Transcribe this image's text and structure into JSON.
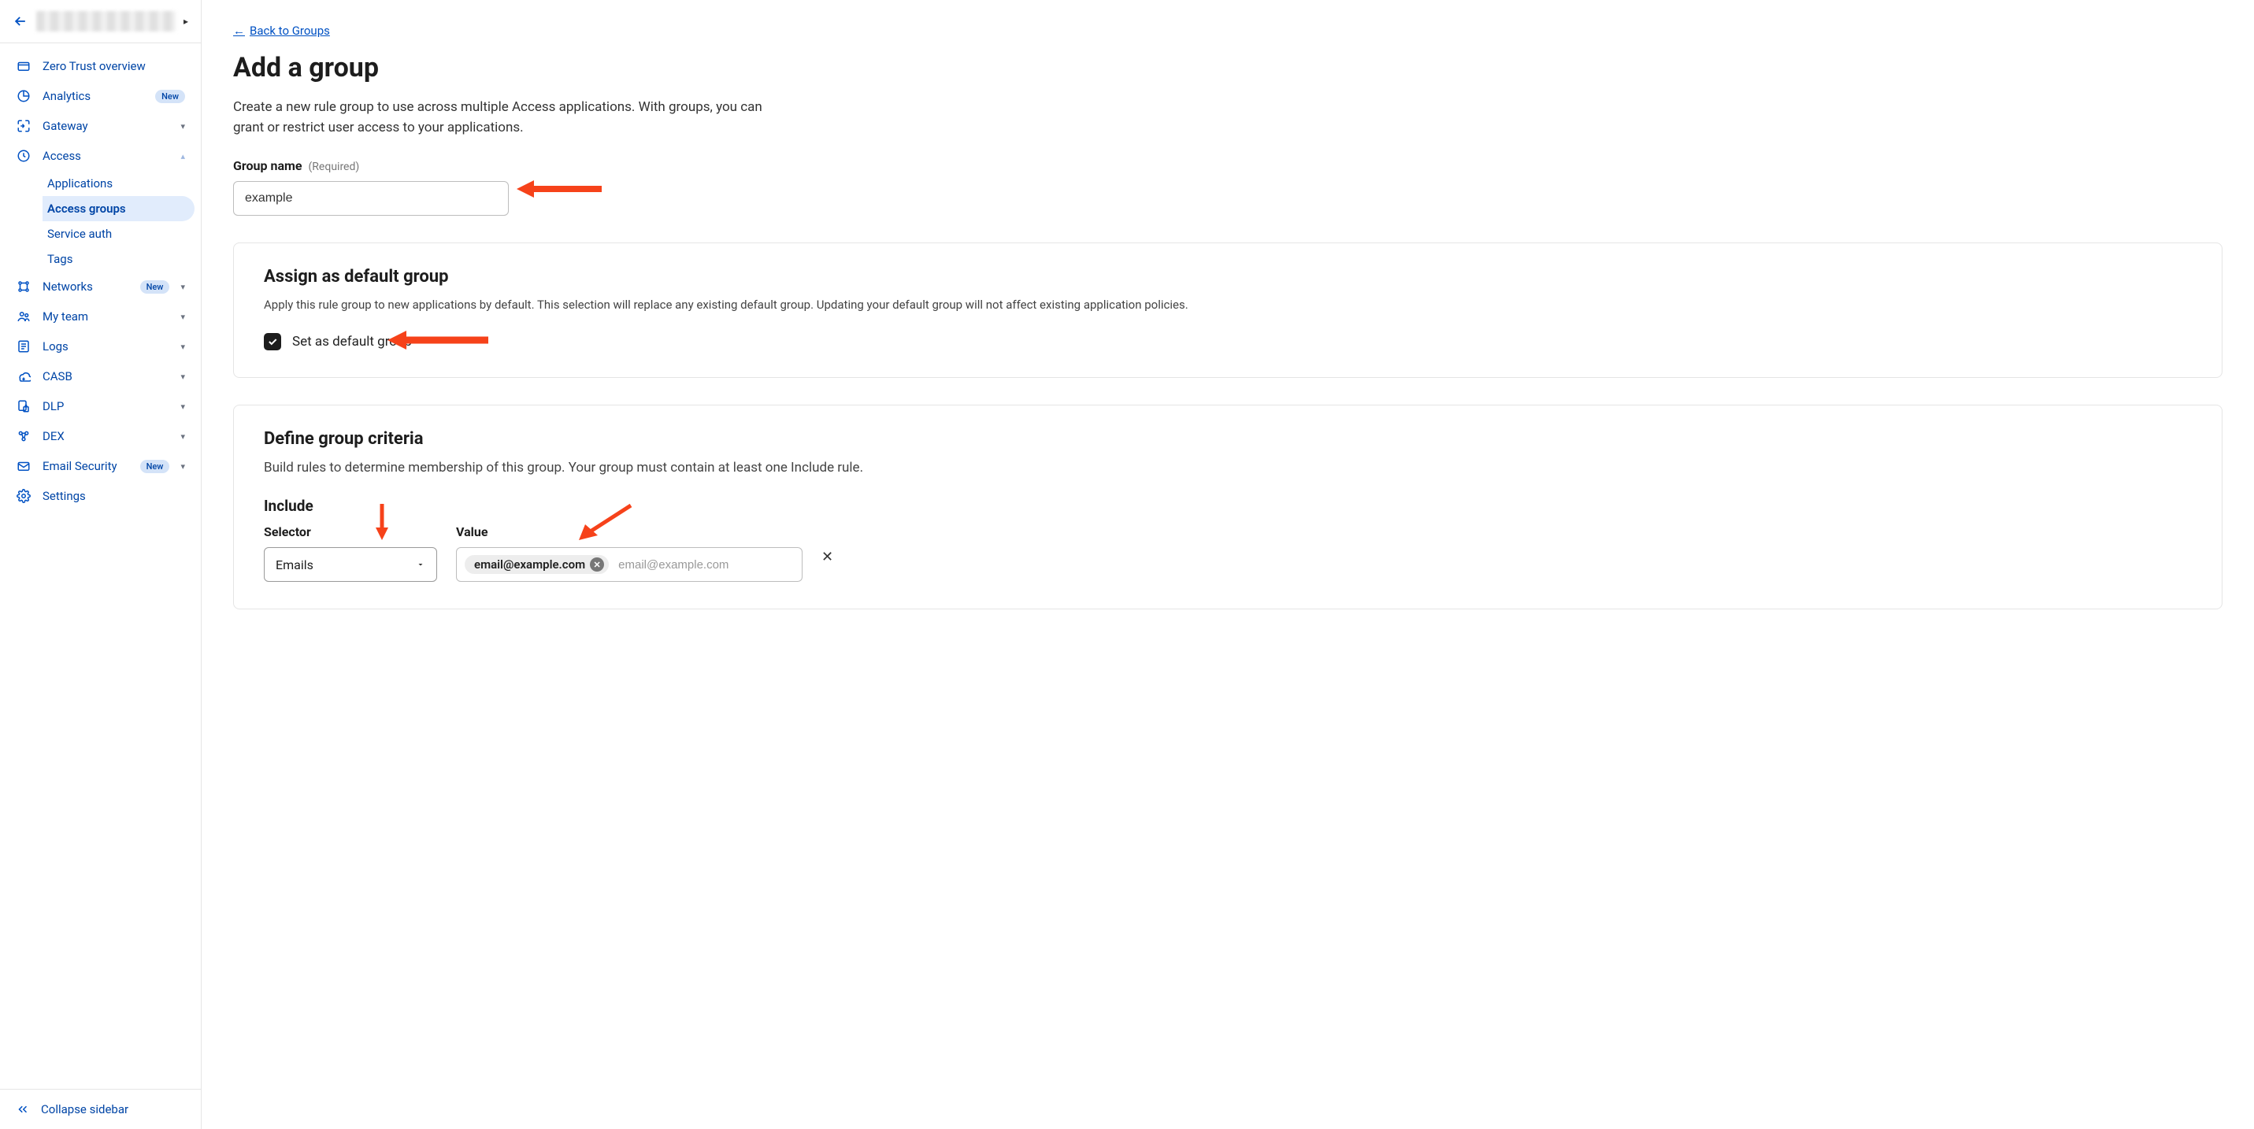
{
  "sidebar": {
    "items": [
      {
        "label": "Zero Trust overview",
        "badge": null,
        "expandable": false
      },
      {
        "label": "Analytics",
        "badge": "New",
        "expandable": false
      },
      {
        "label": "Gateway",
        "badge": null,
        "expandable": true
      },
      {
        "label": "Access",
        "badge": null,
        "expandable": true,
        "expanded": true,
        "children": [
          {
            "label": "Applications",
            "active": false
          },
          {
            "label": "Access groups",
            "active": true
          },
          {
            "label": "Service auth",
            "active": false
          },
          {
            "label": "Tags",
            "active": false
          }
        ]
      },
      {
        "label": "Networks",
        "badge": "New",
        "expandable": true
      },
      {
        "label": "My team",
        "badge": null,
        "expandable": true
      },
      {
        "label": "Logs",
        "badge": null,
        "expandable": true
      },
      {
        "label": "CASB",
        "badge": null,
        "expandable": true
      },
      {
        "label": "DLP",
        "badge": null,
        "expandable": true
      },
      {
        "label": "DEX",
        "badge": null,
        "expandable": true
      },
      {
        "label": "Email Security",
        "badge": "New",
        "expandable": true
      },
      {
        "label": "Settings",
        "badge": null,
        "expandable": false
      }
    ],
    "collapse_label": "Collapse sidebar"
  },
  "page": {
    "back_link": "Back to Groups",
    "title": "Add a group",
    "description": "Create a new rule group to use across multiple Access applications. With groups, you can grant or restrict user access to your applications.",
    "group_name_label": "Group name",
    "group_name_required": "(Required)",
    "group_name_value": "example",
    "default_section": {
      "title": "Assign as default group",
      "description": "Apply this rule group to new applications by default. This selection will replace any existing default group. Updating your default group will not affect existing application policies.",
      "checkbox_label": "Set as default group",
      "checked": true
    },
    "criteria_section": {
      "title": "Define group criteria",
      "description": "Build rules to determine membership of this group. Your group must contain at least one Include rule.",
      "include_heading": "Include",
      "selector_label": "Selector",
      "selector_value": "Emails",
      "value_label": "Value",
      "value_chip": "email@example.com",
      "value_placeholder": "email@example.com"
    }
  }
}
